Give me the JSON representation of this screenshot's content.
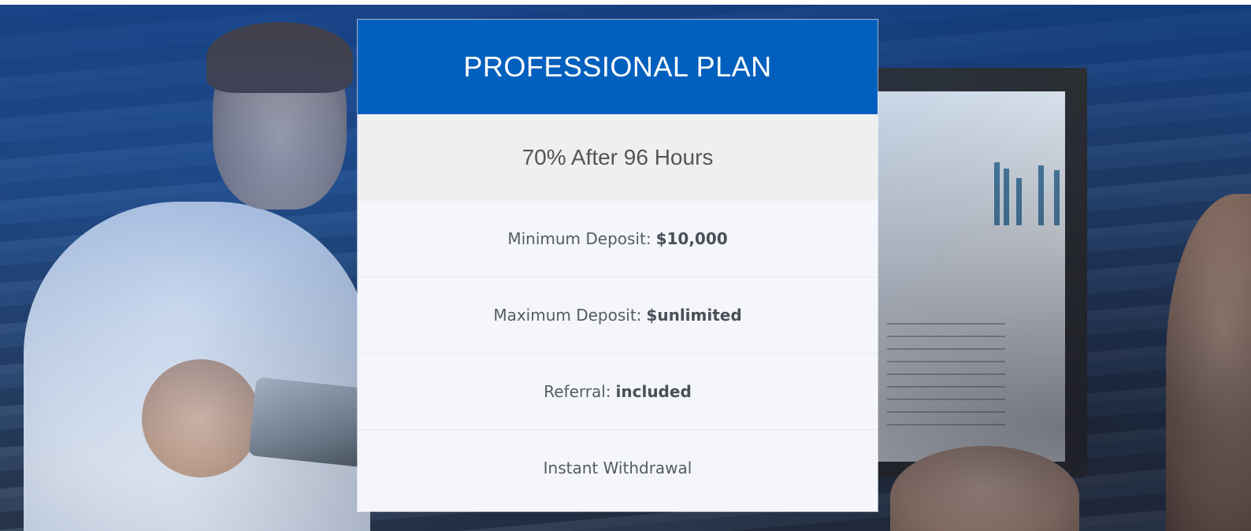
{
  "plan": {
    "title": "PROFESSIONAL PLAN",
    "rate": "70% After 96 Hours",
    "features": [
      {
        "label": "Minimum Deposit:",
        "value": "$10,000"
      },
      {
        "label": "Maximum Deposit:",
        "value": "$unlimited"
      },
      {
        "label": "Referral:",
        "value": "included"
      },
      {
        "label": "Instant Withdrawal",
        "value": ""
      }
    ]
  },
  "colors": {
    "header_bg": "#0160bd",
    "rate_bg": "#efeff0",
    "card_bg": "#f4f6fb"
  }
}
